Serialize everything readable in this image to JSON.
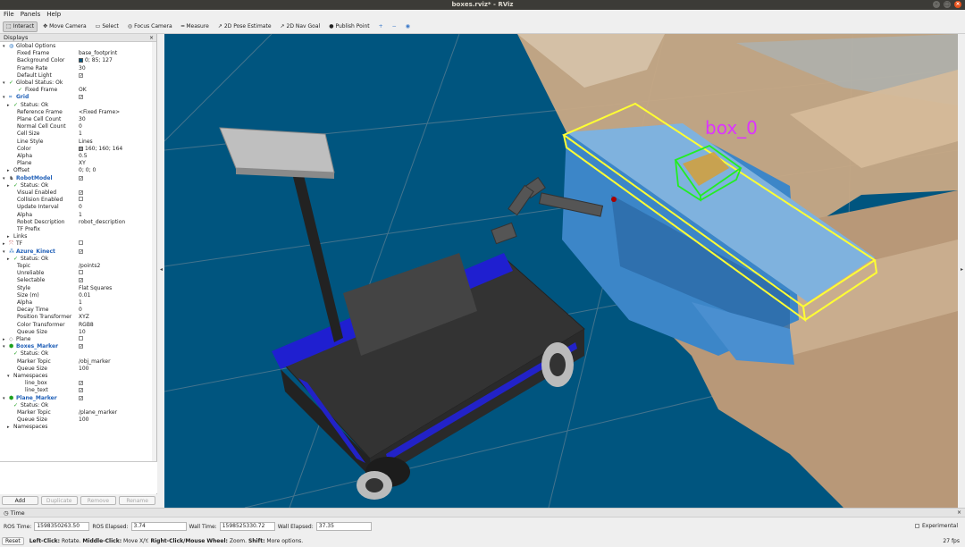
{
  "window": {
    "title": "boxes.rviz* - RViz"
  },
  "menu": [
    "File",
    "Panels",
    "Help"
  ],
  "toolbar": [
    {
      "label": "Interact",
      "icon": "interact-icon",
      "glyph": "⬚",
      "active": true
    },
    {
      "label": "Move Camera",
      "icon": "move-camera-icon",
      "glyph": "✥",
      "active": false
    },
    {
      "label": "Select",
      "icon": "select-icon",
      "glyph": "▭",
      "active": false
    },
    {
      "label": "Focus Camera",
      "icon": "focus-camera-icon",
      "glyph": "◎",
      "active": false
    },
    {
      "label": "Measure",
      "icon": "measure-icon",
      "glyph": "━",
      "active": false
    },
    {
      "label": "2D Pose Estimate",
      "icon": "pose-estimate-icon",
      "glyph": "↗",
      "active": false
    },
    {
      "label": "2D Nav Goal",
      "icon": "nav-goal-icon",
      "glyph": "↗",
      "active": false
    },
    {
      "label": "Publish Point",
      "icon": "publish-point-icon",
      "glyph": "●",
      "active": false
    }
  ],
  "toolbar_extra": [
    "+",
    "−",
    "◉"
  ],
  "displays_panel": {
    "title": "Displays",
    "close": "×",
    "rows": [
      {
        "indent": 0,
        "arrow": "▾",
        "icon": "globe",
        "label": "Global Options",
        "value": ""
      },
      {
        "indent": 2,
        "label": "Fixed Frame",
        "value": "base_footprint"
      },
      {
        "indent": 2,
        "label": "Background Color",
        "value": "0; 85; 127",
        "swatch": "#00557f"
      },
      {
        "indent": 2,
        "label": "Frame Rate",
        "value": "30"
      },
      {
        "indent": 2,
        "label": "Default Light",
        "check": true
      },
      {
        "indent": 0,
        "arrow": "▾",
        "icon": "check",
        "label": "Global Status: Ok",
        "value": ""
      },
      {
        "indent": 2,
        "icon": "check",
        "label": "Fixed Frame",
        "value": "OK"
      },
      {
        "indent": 0,
        "arrow": "▾",
        "icon": "grid",
        "label": "Grid",
        "blue": true,
        "check": true
      },
      {
        "indent": 1,
        "arrow": "▸",
        "icon": "check",
        "label": "Status: Ok",
        "value": ""
      },
      {
        "indent": 2,
        "label": "Reference Frame",
        "value": "<Fixed Frame>"
      },
      {
        "indent": 2,
        "label": "Plane Cell Count",
        "value": "30"
      },
      {
        "indent": 2,
        "label": "Normal Cell Count",
        "value": "0"
      },
      {
        "indent": 2,
        "label": "Cell Size",
        "value": "1"
      },
      {
        "indent": 2,
        "label": "Line Style",
        "value": "Lines"
      },
      {
        "indent": 2,
        "label": "Color",
        "value": "160; 160; 164",
        "swatch": "#a0a0a4"
      },
      {
        "indent": 2,
        "label": "Alpha",
        "value": "0.5"
      },
      {
        "indent": 2,
        "label": "Plane",
        "value": "XY"
      },
      {
        "indent": 1,
        "arrow": "▸",
        "label": "Offset",
        "value": "0; 0; 0"
      },
      {
        "indent": 0,
        "arrow": "▾",
        "icon": "robot",
        "label": "RobotModel",
        "blue": true,
        "check": true
      },
      {
        "indent": 1,
        "arrow": "▸",
        "icon": "check",
        "label": "Status: Ok",
        "value": ""
      },
      {
        "indent": 2,
        "label": "Visual Enabled",
        "check": true
      },
      {
        "indent": 2,
        "label": "Collision Enabled",
        "check": false
      },
      {
        "indent": 2,
        "label": "Update Interval",
        "value": "0"
      },
      {
        "indent": 2,
        "label": "Alpha",
        "value": "1"
      },
      {
        "indent": 2,
        "label": "Robot Description",
        "value": "robot_description"
      },
      {
        "indent": 2,
        "label": "TF Prefix",
        "value": ""
      },
      {
        "indent": 1,
        "arrow": "▸",
        "label": "Links",
        "value": ""
      },
      {
        "indent": 0,
        "arrow": "▸",
        "icon": "tf",
        "label": "TF",
        "check": false
      },
      {
        "indent": 0,
        "arrow": "▾",
        "icon": "cloud",
        "label": "Azure_Kinect",
        "blue": true,
        "check": true
      },
      {
        "indent": 1,
        "arrow": "▸",
        "icon": "check",
        "label": "Status: Ok",
        "value": ""
      },
      {
        "indent": 2,
        "label": "Topic",
        "value": "/points2"
      },
      {
        "indent": 2,
        "label": "Unreliable",
        "check": false
      },
      {
        "indent": 2,
        "label": "Selectable",
        "check": true
      },
      {
        "indent": 2,
        "label": "Style",
        "value": "Flat Squares"
      },
      {
        "indent": 2,
        "label": "Size (m)",
        "value": "0.01"
      },
      {
        "indent": 2,
        "label": "Alpha",
        "value": "1"
      },
      {
        "indent": 2,
        "label": "Decay Time",
        "value": "0"
      },
      {
        "indent": 2,
        "label": "Position Transformer",
        "value": "XYZ"
      },
      {
        "indent": 2,
        "label": "Color Transformer",
        "value": "RGB8"
      },
      {
        "indent": 2,
        "label": "Queue Size",
        "value": "10"
      },
      {
        "indent": 0,
        "arrow": "▸",
        "icon": "plane",
        "label": "Plane",
        "check": false
      },
      {
        "indent": 0,
        "arrow": "▾",
        "icon": "marker",
        "label": "Boxes_Marker",
        "blue": true,
        "check": true
      },
      {
        "indent": 1,
        "arrow": "",
        "icon": "check",
        "label": "Status: Ok",
        "value": ""
      },
      {
        "indent": 2,
        "label": "Marker Topic",
        "value": "/obj_marker"
      },
      {
        "indent": 2,
        "label": "Queue Size",
        "value": "100"
      },
      {
        "indent": 1,
        "arrow": "▾",
        "label": "Namespaces",
        "value": ""
      },
      {
        "indent": 3,
        "label": "line_box",
        "check": true
      },
      {
        "indent": 3,
        "label": "line_text",
        "check": true
      },
      {
        "indent": 0,
        "arrow": "▾",
        "icon": "marker",
        "label": "Plane_Marker",
        "blue": true,
        "check": true
      },
      {
        "indent": 1,
        "arrow": "",
        "icon": "check",
        "label": "Status: Ok",
        "value": ""
      },
      {
        "indent": 2,
        "label": "Marker Topic",
        "value": "/plane_marker"
      },
      {
        "indent": 2,
        "label": "Queue Size",
        "value": "100"
      },
      {
        "indent": 1,
        "arrow": "▸",
        "label": "Namespaces",
        "value": ""
      }
    ],
    "buttons": [
      {
        "label": "Add",
        "disabled": false
      },
      {
        "label": "Duplicate",
        "disabled": true
      },
      {
        "label": "Remove",
        "disabled": true
      },
      {
        "label": "Rename",
        "disabled": true
      }
    ]
  },
  "viewport": {
    "box_label": "box_0",
    "background": "#00557f",
    "grid_color": "#7a8d9a",
    "box_color": "#ffff33",
    "small_box_color": "#22ee22",
    "label_color": "#dd33ff"
  },
  "time_panel": {
    "title": "Time",
    "ros_time_label": "ROS Time:",
    "ros_time": "1598350263.50",
    "ros_elapsed_label": "ROS Elapsed:",
    "ros_elapsed": "3.74",
    "wall_time_label": "Wall Time:",
    "wall_time": "1598525330.72",
    "wall_elapsed_label": "Wall Elapsed:",
    "wall_elapsed": "37.35",
    "experimental_label": "Experimental"
  },
  "status": {
    "reset": "Reset",
    "left_click_key": "Left-Click:",
    "left_click": "Rotate.",
    "middle_click_key": "Middle-Click:",
    "middle_click": "Move X/Y.",
    "right_click_key": "Right-Click/Mouse Wheel:",
    "right_click": "Zoom.",
    "shift_key": "Shift:",
    "shift": "More options.",
    "fps": "27 fps"
  }
}
